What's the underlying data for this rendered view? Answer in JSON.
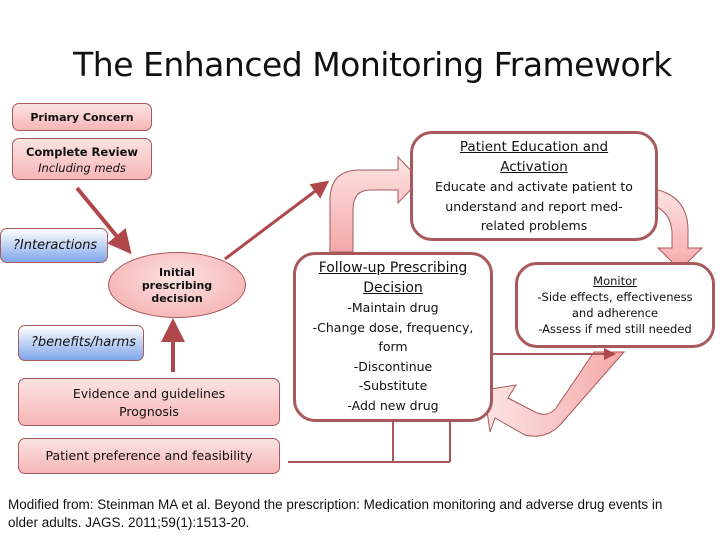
{
  "title": "The Enhanced Monitoring Framework",
  "left_column": {
    "primary_concern": "Primary Concern",
    "complete_review": {
      "title": "Complete Review",
      "subtitle": "Including meds"
    },
    "interactions": "?Interactions",
    "benefits_harms": "?benefits/harms",
    "evidence": {
      "line1": "Evidence and guidelines",
      "line2": "Prognosis"
    },
    "patient_preference": "Patient preference and feasibility"
  },
  "initial_decision": {
    "line1": "Initial",
    "line2": "prescribing",
    "line3": "decision"
  },
  "patient_education": {
    "title_line1": "Patient Education and",
    "title_line2": "Activation",
    "body_line1": "Educate and activate patient to",
    "body_line2": "understand and report med-",
    "body_line3": "related problems"
  },
  "follow_up": {
    "title_line1": "Follow-up Prescribing",
    "title_line2": "Decision",
    "items": [
      "-Maintain drug",
      "-Change dose, frequency,",
      "form",
      "-Discontinue",
      "-Substitute",
      "-Add new drug"
    ]
  },
  "monitor": {
    "title": "Monitor",
    "items": [
      "-Side effects, effectiveness",
      "and adherence",
      "-Assess if med still needed"
    ]
  },
  "citation": {
    "line1": "Modified from:  Steinman MA et al. Beyond the prescription: Medication monitoring and adverse drug events in",
    "line2": "older adults. JAGS. 2011;59(1):1513-20."
  },
  "colors": {
    "accent_dark_red": "#a8595b",
    "pink_fill": "#f7b6b6",
    "blue_fill": "#7fa6ea"
  }
}
